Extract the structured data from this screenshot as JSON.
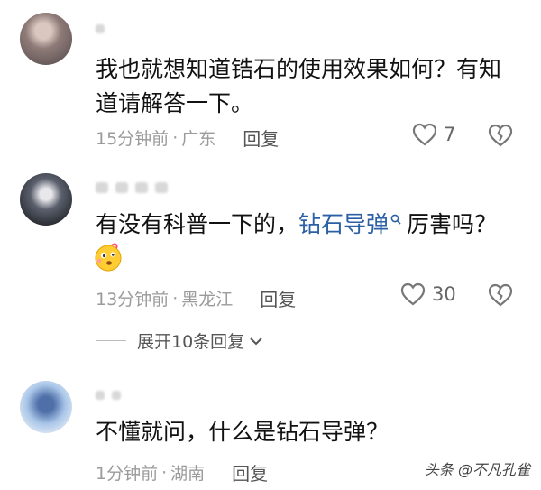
{
  "comments": [
    {
      "text_line1": "我也就想知道锆石的使用效果如何？有知",
      "text_line2": "道请解答一下。",
      "time": "15分钟前",
      "location": "广东",
      "reply_label": "回复",
      "likes": "7"
    },
    {
      "text_before": "有没有科普一下的，",
      "link_text": "钻石导弹",
      "text_after": "厉害吗？",
      "time": "13分钟前",
      "location": "黑龙江",
      "reply_label": "回复",
      "likes": "30"
    },
    {
      "text": "不懂就问，什么是钻石导弹？",
      "time": "1分钟前",
      "location": "湖南",
      "reply_label": "回复"
    }
  ],
  "expand_label": "展开10条回复",
  "separator": "·",
  "watermark": "头条 @不凡孔雀",
  "colors": {
    "link": "#2b5fa6",
    "meta": "#9b9b9b"
  },
  "icons": [
    "heart-icon",
    "broken-heart-icon",
    "search-icon",
    "chevron-down-icon",
    "emoji-icon"
  ]
}
